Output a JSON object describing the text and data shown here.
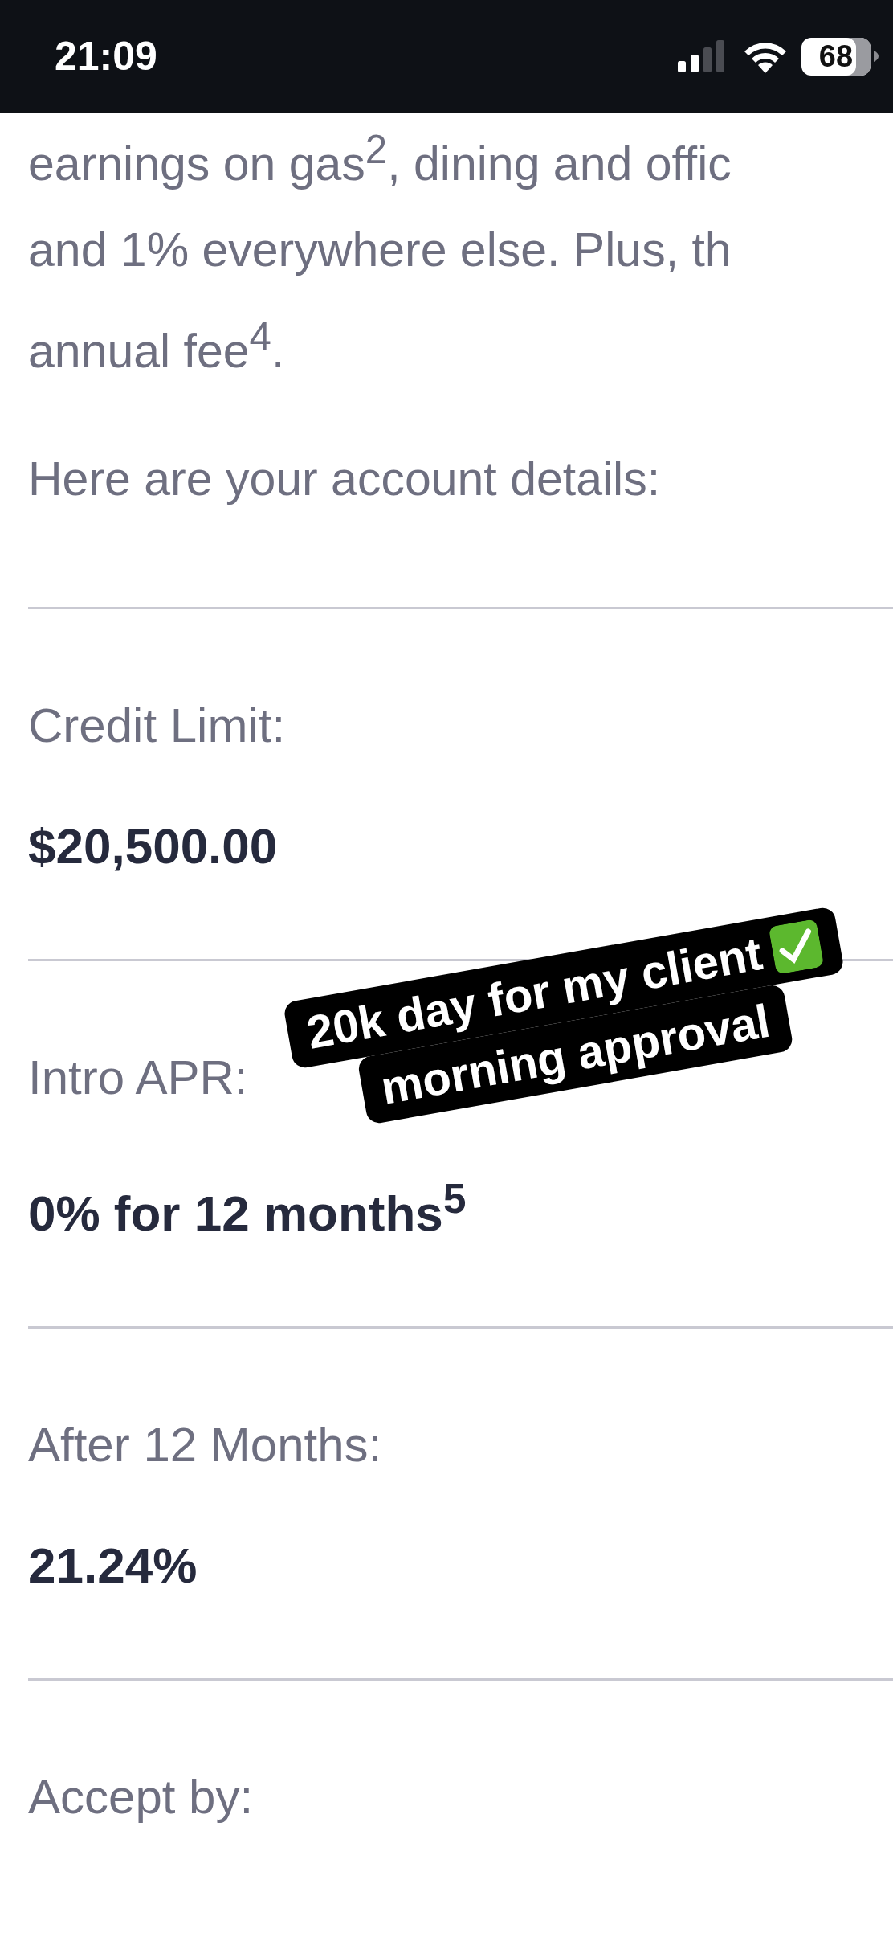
{
  "status_bar": {
    "time": "21:09",
    "battery": "68"
  },
  "intro_lines": [
    "earnings on gas$^{2}$, dining and offic",
    "and 1% everywhere else. Plus, th",
    "annual fee$^{4}$."
  ],
  "heading": "Here are your account details:",
  "details": [
    {
      "label": "Credit Limit:",
      "value": "$20,500.00"
    },
    {
      "label": "Intro APR:",
      "value": "0% for 12 months$^{5}$"
    },
    {
      "label": "After 12 Months:",
      "value": "21.24%"
    },
    {
      "label": "Accept by:"
    }
  ],
  "sticker": {
    "lines": [
      "20k day for my client",
      "morning approval"
    ]
  }
}
